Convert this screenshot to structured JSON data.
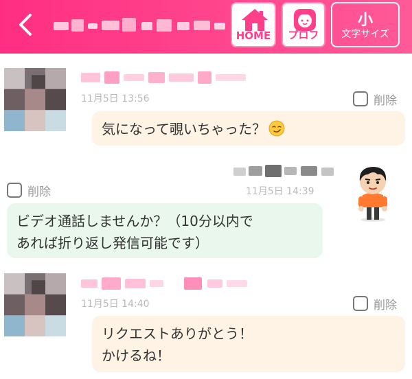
{
  "header": {
    "home_label": "HOME",
    "profile_label": "プロフ",
    "font_size_value": "小",
    "font_size_label": "文字サイズ"
  },
  "messages": [
    {
      "direction": "received",
      "timestamp": "11月5日 13:56",
      "delete_label": "削除",
      "lines": [
        "気になって覗いちゃった？"
      ],
      "emoji": "smirk-icon"
    },
    {
      "direction": "sent",
      "timestamp": "11月5日 14:39",
      "delete_label": "削除",
      "lines": [
        "ビデオ通話しませんか？（10分以内で",
        "あれば折り返し発信可能です）"
      ]
    },
    {
      "direction": "received",
      "timestamp": "11月5日 14:40",
      "delete_label": "削除",
      "lines": [
        "リクエストありがとう！",
        "かけるね！"
      ]
    }
  ],
  "colors": {
    "header_pink": "#ff3f8a",
    "received_bubble": "#fff3e6",
    "sent_bubble": "#e9f7ec",
    "timestamp_gray": "#b9b9b9"
  }
}
